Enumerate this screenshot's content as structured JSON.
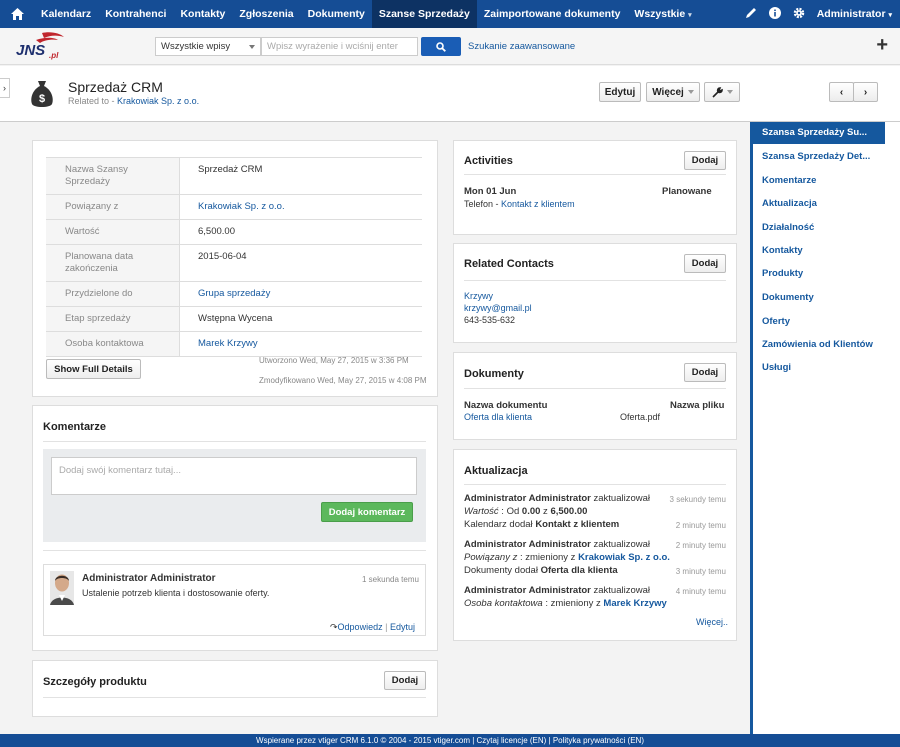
{
  "nav": {
    "tabs": [
      "Kalendarz",
      "Kontrahenci",
      "Kontakty",
      "Zgłoszenia",
      "Dokumenty",
      "Szanse Sprzedaży",
      "Zaimportowane dokumenty",
      "Wszystkie"
    ],
    "active_tab": "Szanse Sprzedaży",
    "user": "Administrator"
  },
  "search": {
    "scope": "Wszystkie wpisy",
    "placeholder": "Wpisz wyrażenie i wciśnij enter",
    "advanced": "Szukanie zaawansowane"
  },
  "logo_text": "JNS.pl",
  "record": {
    "title": "Sprzedaż CRM",
    "related_prefix": "Related to - ",
    "related_link": "Krakowiak Sp. z o.o.",
    "edit": "Edytuj",
    "more": "Więcej"
  },
  "details": {
    "rows": [
      {
        "label": "Nazwa Szansy Sprzedaży",
        "value": "Sprzedaż CRM"
      },
      {
        "label": "Powiązany z",
        "value": "Krakowiak Sp. z o.o."
      },
      {
        "label": "Wartość",
        "value": "6,500.00"
      },
      {
        "label": "Planowana data zakończenia",
        "value": "2015-06-04"
      },
      {
        "label": "Przydzielone do",
        "value": "Grupa sprzedaży"
      },
      {
        "label": "Etap sprzedaży",
        "value": "Wstępna Wycena"
      },
      {
        "label": "Osoba kontaktowa",
        "value": "Marek Krzywy"
      }
    ],
    "show_full": "Show Full Details",
    "created": "Utworzono Wed, May 27, 2015 w 3:36 PM",
    "modified": "Zmodyfikowano Wed, May 27, 2015 w 4:08 PM"
  },
  "comments": {
    "title": "Komentarze",
    "placeholder": "Dodaj swój komentarz tutaj...",
    "add": "Dodaj komentarz",
    "author": "Administrator Administrator",
    "time": "1 sekunda temu",
    "text": "Ustalenie potrzeb klienta i dostosowanie oferty.",
    "reply": "Odpowiedz",
    "sep": "|",
    "edit": "Edytuj"
  },
  "product": {
    "title": "Szczegóły produktu",
    "add": "Dodaj"
  },
  "activities": {
    "title": "Activities",
    "add": "Dodaj",
    "date": "Mon 01 Jun",
    "status": "Planowane",
    "type": "Telefon - ",
    "link": "Kontakt z klientem"
  },
  "contacts": {
    "title": "Related Contacts",
    "add": "Dodaj",
    "name": "Krzywy",
    "email": "krzywy@gmail.pl",
    "phone": "643-535-632"
  },
  "documents": {
    "title": "Dokumenty",
    "add": "Dodaj",
    "col_name": "Nazwa dokumentu",
    "col_file": "Nazwa pliku",
    "doc": "Oferta dla klienta",
    "file": "Oferta.pdf"
  },
  "updates": {
    "title": "Aktualizacja",
    "more": "Więcej..",
    "u1_author": "Administrator Administrator",
    "u1_action": " zaktualizował",
    "u1_time": "3 sekundy temu",
    "u1_field": "Wartość",
    "u1_detail_pre": " :  Od ",
    "u1_from": "0.00",
    "u1_to_word": " z ",
    "u1_to": "6,500.00",
    "u2_pre": "Kalendarz dodał ",
    "u2_obj": "Kontakt z klientem",
    "u2_time": "2 minuty temu",
    "u3_author": "Administrator Administrator",
    "u3_action": " zaktualizował",
    "u3_time": "2 minuty temu",
    "u3_field": "Powiązany z",
    "u3_detail_pre": " :  zmieniony z ",
    "u3_to": "Krakowiak Sp. z o.o.",
    "u4_pre": "Dokumenty dodał ",
    "u4_obj": "Oferta dla klienta",
    "u4_time": "3 minuty temu",
    "u5_author": "Administrator Administrator",
    "u5_action": " zaktualizował",
    "u5_time": "4 minuty temu",
    "u5_field": "Osoba kontaktowa",
    "u5_detail_pre": " :  zmieniony z ",
    "u5_to": "Marek Krzywy"
  },
  "sidebar": {
    "items": [
      "Szansa Sprzedaży Su...",
      "Szansa Sprzedaży Det...",
      "Komentarze",
      "Aktualizacja",
      "Działalność",
      "Kontakty",
      "Produkty",
      "Dokumenty",
      "Oferty",
      "Zamówienia od Klientów",
      "Usługi"
    ]
  },
  "footer": "Wspierane przez vtiger CRM 6.1.0  © 2004 - 2015  vtiger.com | Czytaj licencje (EN) | Polityka prywatności (EN)",
  "colors": {
    "nav": "#154d95",
    "nav_active": "#0d3263",
    "link": "#15589e",
    "green": "#5cb85c"
  }
}
